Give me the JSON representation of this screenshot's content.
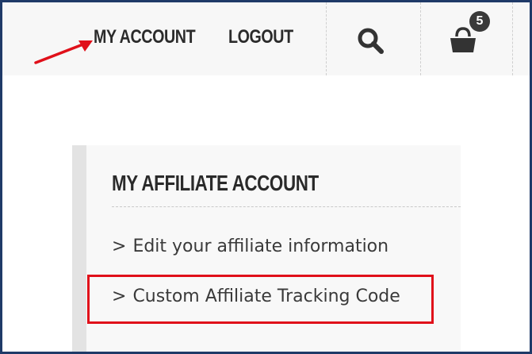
{
  "header": {
    "nav": {
      "my_account": "MY ACCOUNT",
      "logout": "LOGOUT"
    },
    "cart": {
      "count": "5"
    },
    "icons": [
      "search-icon",
      "shopping-bag-icon"
    ]
  },
  "affiliate_panel": {
    "title": "MY AFFILIATE ACCOUNT",
    "links": [
      {
        "chevron": ">",
        "label": "Edit your affiliate information"
      },
      {
        "chevron": ">",
        "label": "Custom Affiliate Tracking Code"
      }
    ]
  },
  "annotations": {
    "arrow_color": "#e0101a",
    "highlight_color": "#e0101a"
  }
}
